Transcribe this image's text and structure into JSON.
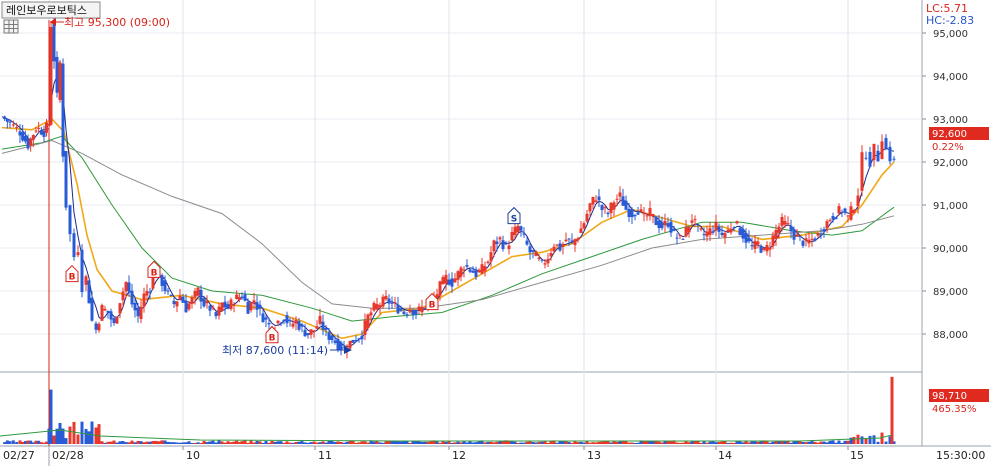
{
  "header": {
    "stock_name": "레인보우로보틱스",
    "indicator_lc": "LC:5.71",
    "indicator_hc": "HC:-2.83"
  },
  "price_badge": {
    "price": "92,600",
    "change_pct": "0.22%"
  },
  "volume_badge": {
    "value": "98,710",
    "pct": "465.35%"
  },
  "time_label": "15:30:00",
  "annotations": {
    "high": "최고 95,300 (09:00)",
    "low": "최저 87,600 (11:14)"
  },
  "signals": [
    {
      "text": "B",
      "kind": "buy"
    },
    {
      "text": "B",
      "kind": "buy"
    },
    {
      "text": "B",
      "kind": "buy"
    },
    {
      "text": "B",
      "kind": "buy"
    },
    {
      "text": "S",
      "kind": "sell"
    }
  ],
  "colors": {
    "up": "#e8372b",
    "down": "#2a5bd7",
    "ma_short": "#1a2a8a",
    "ma_mid": "#f0a818",
    "ma_long": "#2e9a3c",
    "ma_longest": "#8c8c8c",
    "badge_bg": "#e02a20"
  },
  "chart_data": {
    "type": "candlestick",
    "price_axis": {
      "ylim": [
        87300,
        95500
      ],
      "ticks": [
        "88,000",
        "89,000",
        "90,000",
        "91,000",
        "92,000",
        "93,000",
        "94,000",
        "95,000"
      ],
      "tick_values": [
        88000,
        89000,
        90000,
        91000,
        92000,
        93000,
        94000,
        95000
      ]
    },
    "x_axis": {
      "ticks": [
        "02/27",
        "02/28",
        "10",
        "11",
        "12",
        "13",
        "14",
        "15"
      ]
    },
    "high": {
      "value": 95300,
      "time": "09:00"
    },
    "low": {
      "value": 87600,
      "time": "11:14"
    },
    "last_price": 92600,
    "close_path": [
      {
        "x": 0,
        "y": 93050
      },
      {
        "x": 8,
        "y": 92900
      },
      {
        "x": 18,
        "y": 92700
      },
      {
        "x": 26,
        "y": 92400
      },
      {
        "x": 34,
        "y": 92800
      },
      {
        "x": 42,
        "y": 92700
      },
      {
        "x": 47,
        "y": 92900
      },
      {
        "x": 49,
        "y": 95200
      },
      {
        "x": 52,
        "y": 94400
      },
      {
        "x": 55,
        "y": 93500
      },
      {
        "x": 58,
        "y": 94300
      },
      {
        "x": 61,
        "y": 92200
      },
      {
        "x": 64,
        "y": 91000
      },
      {
        "x": 68,
        "y": 90300
      },
      {
        "x": 72,
        "y": 89800
      },
      {
        "x": 76,
        "y": 90000
      },
      {
        "x": 80,
        "y": 89100
      },
      {
        "x": 84,
        "y": 89300
      },
      {
        "x": 90,
        "y": 88300
      },
      {
        "x": 94,
        "y": 88100
      },
      {
        "x": 100,
        "y": 88600
      },
      {
        "x": 106,
        "y": 88500
      },
      {
        "x": 112,
        "y": 88200
      },
      {
        "x": 118,
        "y": 88800
      },
      {
        "x": 124,
        "y": 89200
      },
      {
        "x": 130,
        "y": 88700
      },
      {
        "x": 136,
        "y": 88400
      },
      {
        "x": 142,
        "y": 88900
      },
      {
        "x": 148,
        "y": 89100
      },
      {
        "x": 154,
        "y": 89500
      },
      {
        "x": 160,
        "y": 89200
      },
      {
        "x": 166,
        "y": 88900
      },
      {
        "x": 172,
        "y": 88700
      },
      {
        "x": 178,
        "y": 88900
      },
      {
        "x": 184,
        "y": 88600
      },
      {
        "x": 190,
        "y": 88800
      },
      {
        "x": 196,
        "y": 89000
      },
      {
        "x": 202,
        "y": 88700
      },
      {
        "x": 208,
        "y": 88600
      },
      {
        "x": 214,
        "y": 88400
      },
      {
        "x": 220,
        "y": 88700
      },
      {
        "x": 226,
        "y": 88600
      },
      {
        "x": 232,
        "y": 88800
      },
      {
        "x": 240,
        "y": 88900
      },
      {
        "x": 246,
        "y": 88600
      },
      {
        "x": 252,
        "y": 88800
      },
      {
        "x": 258,
        "y": 88500
      },
      {
        "x": 264,
        "y": 88300
      },
      {
        "x": 270,
        "y": 88100
      },
      {
        "x": 276,
        "y": 88300
      },
      {
        "x": 282,
        "y": 88400
      },
      {
        "x": 288,
        "y": 88200
      },
      {
        "x": 294,
        "y": 88300
      },
      {
        "x": 300,
        "y": 88100
      },
      {
        "x": 306,
        "y": 88000
      },
      {
        "x": 312,
        "y": 88100
      },
      {
        "x": 318,
        "y": 88300
      },
      {
        "x": 324,
        "y": 88000
      },
      {
        "x": 330,
        "y": 87900
      },
      {
        "x": 336,
        "y": 87750
      },
      {
        "x": 342,
        "y": 87650
      },
      {
        "x": 348,
        "y": 87800
      },
      {
        "x": 354,
        "y": 87900
      },
      {
        "x": 360,
        "y": 88000
      },
      {
        "x": 366,
        "y": 88400
      },
      {
        "x": 372,
        "y": 88600
      },
      {
        "x": 378,
        "y": 88700
      },
      {
        "x": 384,
        "y": 88800
      },
      {
        "x": 390,
        "y": 88700
      },
      {
        "x": 396,
        "y": 88600
      },
      {
        "x": 402,
        "y": 88500
      },
      {
        "x": 408,
        "y": 88600
      },
      {
        "x": 414,
        "y": 88500
      },
      {
        "x": 420,
        "y": 88600
      },
      {
        "x": 426,
        "y": 88700
      },
      {
        "x": 432,
        "y": 88800
      },
      {
        "x": 438,
        "y": 89100
      },
      {
        "x": 444,
        "y": 89300
      },
      {
        "x": 450,
        "y": 89200
      },
      {
        "x": 456,
        "y": 89400
      },
      {
        "x": 462,
        "y": 89600
      },
      {
        "x": 468,
        "y": 89500
      },
      {
        "x": 474,
        "y": 89400
      },
      {
        "x": 480,
        "y": 89500
      },
      {
        "x": 486,
        "y": 89700
      },
      {
        "x": 492,
        "y": 90100
      },
      {
        "x": 498,
        "y": 90200
      },
      {
        "x": 504,
        "y": 90000
      },
      {
        "x": 510,
        "y": 90300
      },
      {
        "x": 516,
        "y": 90500
      },
      {
        "x": 522,
        "y": 90200
      },
      {
        "x": 528,
        "y": 89900
      },
      {
        "x": 534,
        "y": 89800
      },
      {
        "x": 540,
        "y": 89600
      },
      {
        "x": 546,
        "y": 89800
      },
      {
        "x": 552,
        "y": 90100
      },
      {
        "x": 558,
        "y": 90000
      },
      {
        "x": 564,
        "y": 90200
      },
      {
        "x": 570,
        "y": 90100
      },
      {
        "x": 576,
        "y": 90300
      },
      {
        "x": 582,
        "y": 90600
      },
      {
        "x": 588,
        "y": 91000
      },
      {
        "x": 594,
        "y": 91200
      },
      {
        "x": 600,
        "y": 90900
      },
      {
        "x": 606,
        "y": 90800
      },
      {
        "x": 612,
        "y": 91100
      },
      {
        "x": 618,
        "y": 91200
      },
      {
        "x": 624,
        "y": 90900
      },
      {
        "x": 630,
        "y": 90800
      },
      {
        "x": 636,
        "y": 90900
      },
      {
        "x": 642,
        "y": 90700
      },
      {
        "x": 648,
        "y": 90800
      },
      {
        "x": 654,
        "y": 90600
      },
      {
        "x": 660,
        "y": 90500
      },
      {
        "x": 666,
        "y": 90600
      },
      {
        "x": 672,
        "y": 90300
      },
      {
        "x": 678,
        "y": 90200
      },
      {
        "x": 684,
        "y": 90400
      },
      {
        "x": 690,
        "y": 90700
      },
      {
        "x": 696,
        "y": 90400
      },
      {
        "x": 702,
        "y": 90300
      },
      {
        "x": 708,
        "y": 90400
      },
      {
        "x": 714,
        "y": 90500
      },
      {
        "x": 720,
        "y": 90300
      },
      {
        "x": 726,
        "y": 90400
      },
      {
        "x": 732,
        "y": 90600
      },
      {
        "x": 738,
        "y": 90400
      },
      {
        "x": 744,
        "y": 90200
      },
      {
        "x": 750,
        "y": 90000
      },
      {
        "x": 756,
        "y": 90100
      },
      {
        "x": 762,
        "y": 89900
      },
      {
        "x": 768,
        "y": 90100
      },
      {
        "x": 774,
        "y": 90400
      },
      {
        "x": 780,
        "y": 90600
      },
      {
        "x": 786,
        "y": 90500
      },
      {
        "x": 792,
        "y": 90300
      },
      {
        "x": 798,
        "y": 90200
      },
      {
        "x": 804,
        "y": 90100
      },
      {
        "x": 810,
        "y": 90200
      },
      {
        "x": 816,
        "y": 90300
      },
      {
        "x": 822,
        "y": 90500
      },
      {
        "x": 828,
        "y": 90700
      },
      {
        "x": 834,
        "y": 90800
      },
      {
        "x": 840,
        "y": 90900
      },
      {
        "x": 846,
        "y": 90700
      },
      {
        "x": 852,
        "y": 91000
      },
      {
        "x": 856,
        "y": 91300
      },
      {
        "x": 860,
        "y": 92100
      },
      {
        "x": 864,
        "y": 92200
      },
      {
        "x": 868,
        "y": 92000
      },
      {
        "x": 872,
        "y": 92300
      },
      {
        "x": 876,
        "y": 92100
      },
      {
        "x": 880,
        "y": 92600
      },
      {
        "x": 884,
        "y": 92300
      },
      {
        "x": 888,
        "y": 92100
      },
      {
        "x": 892,
        "y": 92000
      }
    ],
    "ma_lines": [
      {
        "color_key": "ma_mid",
        "points": [
          {
            "x": 0,
            "y": 92800
          },
          {
            "x": 30,
            "y": 92750
          },
          {
            "x": 50,
            "y": 93000
          },
          {
            "x": 62,
            "y": 92700
          },
          {
            "x": 75,
            "y": 91500
          },
          {
            "x": 85,
            "y": 90300
          },
          {
            "x": 95,
            "y": 89500
          },
          {
            "x": 110,
            "y": 89000
          },
          {
            "x": 140,
            "y": 88800
          },
          {
            "x": 180,
            "y": 88900
          },
          {
            "x": 220,
            "y": 88700
          },
          {
            "x": 260,
            "y": 88600
          },
          {
            "x": 300,
            "y": 88300
          },
          {
            "x": 340,
            "y": 87900
          },
          {
            "x": 360,
            "y": 88000
          },
          {
            "x": 380,
            "y": 88500
          },
          {
            "x": 420,
            "y": 88600
          },
          {
            "x": 450,
            "y": 89000
          },
          {
            "x": 480,
            "y": 89400
          },
          {
            "x": 510,
            "y": 89800
          },
          {
            "x": 540,
            "y": 89900
          },
          {
            "x": 570,
            "y": 90100
          },
          {
            "x": 600,
            "y": 90600
          },
          {
            "x": 630,
            "y": 90900
          },
          {
            "x": 660,
            "y": 90700
          },
          {
            "x": 690,
            "y": 90500
          },
          {
            "x": 720,
            "y": 90500
          },
          {
            "x": 760,
            "y": 90200
          },
          {
            "x": 800,
            "y": 90300
          },
          {
            "x": 840,
            "y": 90500
          },
          {
            "x": 860,
            "y": 91000
          },
          {
            "x": 880,
            "y": 91700
          },
          {
            "x": 892,
            "y": 92000
          }
        ]
      },
      {
        "color_key": "ma_long",
        "points": [
          {
            "x": 0,
            "y": 92300
          },
          {
            "x": 40,
            "y": 92450
          },
          {
            "x": 60,
            "y": 92600
          },
          {
            "x": 80,
            "y": 92100
          },
          {
            "x": 110,
            "y": 91000
          },
          {
            "x": 140,
            "y": 90000
          },
          {
            "x": 170,
            "y": 89300
          },
          {
            "x": 210,
            "y": 89000
          },
          {
            "x": 260,
            "y": 88900
          },
          {
            "x": 310,
            "y": 88600
          },
          {
            "x": 350,
            "y": 88300
          },
          {
            "x": 390,
            "y": 88400
          },
          {
            "x": 440,
            "y": 88500
          },
          {
            "x": 490,
            "y": 88900
          },
          {
            "x": 540,
            "y": 89400
          },
          {
            "x": 590,
            "y": 89800
          },
          {
            "x": 640,
            "y": 90200
          },
          {
            "x": 700,
            "y": 90600
          },
          {
            "x": 740,
            "y": 90600
          },
          {
            "x": 790,
            "y": 90400
          },
          {
            "x": 830,
            "y": 90300
          },
          {
            "x": 860,
            "y": 90400
          },
          {
            "x": 892,
            "y": 90950
          }
        ]
      },
      {
        "color_key": "ma_longest",
        "points": [
          {
            "x": 0,
            "y": 92200
          },
          {
            "x": 50,
            "y": 92500
          },
          {
            "x": 80,
            "y": 92200
          },
          {
            "x": 120,
            "y": 91700
          },
          {
            "x": 170,
            "y": 91200
          },
          {
            "x": 220,
            "y": 90800
          },
          {
            "x": 260,
            "y": 90100
          },
          {
            "x": 300,
            "y": 89200
          },
          {
            "x": 330,
            "y": 88700
          },
          {
            "x": 370,
            "y": 88600
          },
          {
            "x": 420,
            "y": 88600
          },
          {
            "x": 480,
            "y": 88800
          },
          {
            "x": 540,
            "y": 89200
          },
          {
            "x": 600,
            "y": 89600
          },
          {
            "x": 650,
            "y": 90000
          },
          {
            "x": 700,
            "y": 90200
          },
          {
            "x": 760,
            "y": 90300
          },
          {
            "x": 820,
            "y": 90400
          },
          {
            "x": 860,
            "y": 90550
          },
          {
            "x": 892,
            "y": 90750
          }
        ]
      }
    ],
    "volume": {
      "ylim": [
        0,
        100000
      ],
      "last": 98710
    }
  }
}
